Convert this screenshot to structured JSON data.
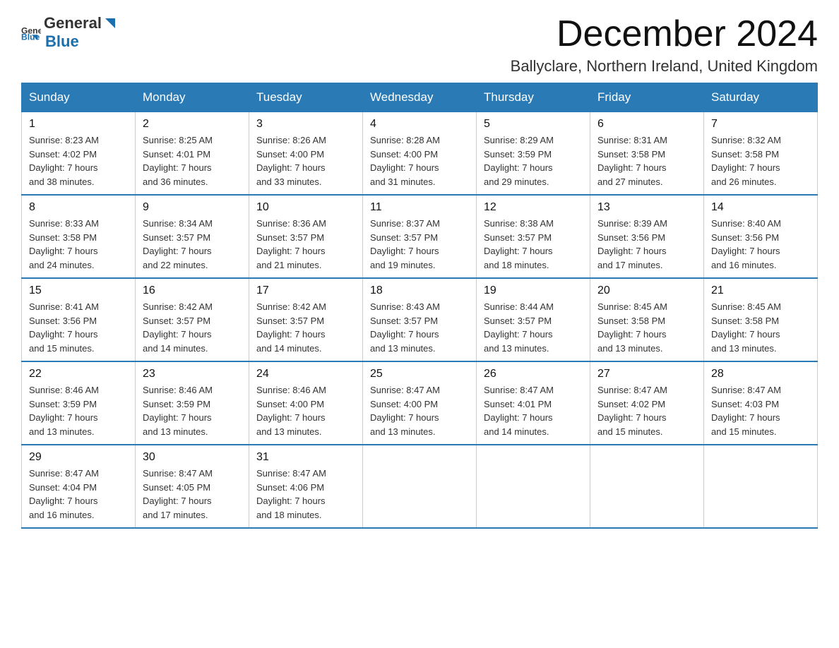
{
  "logo": {
    "general": "General",
    "blue": "Blue"
  },
  "header": {
    "month": "December 2024",
    "location": "Ballyclare, Northern Ireland, United Kingdom"
  },
  "days_of_week": [
    "Sunday",
    "Monday",
    "Tuesday",
    "Wednesday",
    "Thursday",
    "Friday",
    "Saturday"
  ],
  "weeks": [
    [
      {
        "day": "1",
        "sunrise": "8:23 AM",
        "sunset": "4:02 PM",
        "daylight": "7 hours and 38 minutes."
      },
      {
        "day": "2",
        "sunrise": "8:25 AM",
        "sunset": "4:01 PM",
        "daylight": "7 hours and 36 minutes."
      },
      {
        "day": "3",
        "sunrise": "8:26 AM",
        "sunset": "4:00 PM",
        "daylight": "7 hours and 33 minutes."
      },
      {
        "day": "4",
        "sunrise": "8:28 AM",
        "sunset": "4:00 PM",
        "daylight": "7 hours and 31 minutes."
      },
      {
        "day": "5",
        "sunrise": "8:29 AM",
        "sunset": "3:59 PM",
        "daylight": "7 hours and 29 minutes."
      },
      {
        "day": "6",
        "sunrise": "8:31 AM",
        "sunset": "3:58 PM",
        "daylight": "7 hours and 27 minutes."
      },
      {
        "day": "7",
        "sunrise": "8:32 AM",
        "sunset": "3:58 PM",
        "daylight": "7 hours and 26 minutes."
      }
    ],
    [
      {
        "day": "8",
        "sunrise": "8:33 AM",
        "sunset": "3:58 PM",
        "daylight": "7 hours and 24 minutes."
      },
      {
        "day": "9",
        "sunrise": "8:34 AM",
        "sunset": "3:57 PM",
        "daylight": "7 hours and 22 minutes."
      },
      {
        "day": "10",
        "sunrise": "8:36 AM",
        "sunset": "3:57 PM",
        "daylight": "7 hours and 21 minutes."
      },
      {
        "day": "11",
        "sunrise": "8:37 AM",
        "sunset": "3:57 PM",
        "daylight": "7 hours and 19 minutes."
      },
      {
        "day": "12",
        "sunrise": "8:38 AM",
        "sunset": "3:57 PM",
        "daylight": "7 hours and 18 minutes."
      },
      {
        "day": "13",
        "sunrise": "8:39 AM",
        "sunset": "3:56 PM",
        "daylight": "7 hours and 17 minutes."
      },
      {
        "day": "14",
        "sunrise": "8:40 AM",
        "sunset": "3:56 PM",
        "daylight": "7 hours and 16 minutes."
      }
    ],
    [
      {
        "day": "15",
        "sunrise": "8:41 AM",
        "sunset": "3:56 PM",
        "daylight": "7 hours and 15 minutes."
      },
      {
        "day": "16",
        "sunrise": "8:42 AM",
        "sunset": "3:57 PM",
        "daylight": "7 hours and 14 minutes."
      },
      {
        "day": "17",
        "sunrise": "8:42 AM",
        "sunset": "3:57 PM",
        "daylight": "7 hours and 14 minutes."
      },
      {
        "day": "18",
        "sunrise": "8:43 AM",
        "sunset": "3:57 PM",
        "daylight": "7 hours and 13 minutes."
      },
      {
        "day": "19",
        "sunrise": "8:44 AM",
        "sunset": "3:57 PM",
        "daylight": "7 hours and 13 minutes."
      },
      {
        "day": "20",
        "sunrise": "8:45 AM",
        "sunset": "3:58 PM",
        "daylight": "7 hours and 13 minutes."
      },
      {
        "day": "21",
        "sunrise": "8:45 AM",
        "sunset": "3:58 PM",
        "daylight": "7 hours and 13 minutes."
      }
    ],
    [
      {
        "day": "22",
        "sunrise": "8:46 AM",
        "sunset": "3:59 PM",
        "daylight": "7 hours and 13 minutes."
      },
      {
        "day": "23",
        "sunrise": "8:46 AM",
        "sunset": "3:59 PM",
        "daylight": "7 hours and 13 minutes."
      },
      {
        "day": "24",
        "sunrise": "8:46 AM",
        "sunset": "4:00 PM",
        "daylight": "7 hours and 13 minutes."
      },
      {
        "day": "25",
        "sunrise": "8:47 AM",
        "sunset": "4:00 PM",
        "daylight": "7 hours and 13 minutes."
      },
      {
        "day": "26",
        "sunrise": "8:47 AM",
        "sunset": "4:01 PM",
        "daylight": "7 hours and 14 minutes."
      },
      {
        "day": "27",
        "sunrise": "8:47 AM",
        "sunset": "4:02 PM",
        "daylight": "7 hours and 15 minutes."
      },
      {
        "day": "28",
        "sunrise": "8:47 AM",
        "sunset": "4:03 PM",
        "daylight": "7 hours and 15 minutes."
      }
    ],
    [
      {
        "day": "29",
        "sunrise": "8:47 AM",
        "sunset": "4:04 PM",
        "daylight": "7 hours and 16 minutes."
      },
      {
        "day": "30",
        "sunrise": "8:47 AM",
        "sunset": "4:05 PM",
        "daylight": "7 hours and 17 minutes."
      },
      {
        "day": "31",
        "sunrise": "8:47 AM",
        "sunset": "4:06 PM",
        "daylight": "7 hours and 18 minutes."
      },
      null,
      null,
      null,
      null
    ]
  ],
  "labels": {
    "sunrise": "Sunrise:",
    "sunset": "Sunset:",
    "daylight": "Daylight:"
  }
}
